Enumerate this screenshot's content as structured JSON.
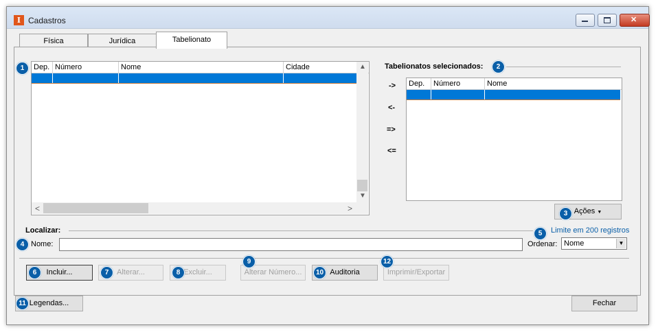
{
  "window": {
    "title": "Cadastros",
    "app_icon_letter": "I",
    "controls": {
      "minimize": "▬",
      "maximize": "□",
      "close": "✕"
    }
  },
  "tabs": [
    {
      "label": "Física",
      "active": false
    },
    {
      "label": "Jurídica",
      "active": false
    },
    {
      "label": "Tabelionato",
      "active": true
    }
  ],
  "left_grid": {
    "badge": "1",
    "columns": [
      "Dep.",
      "Número",
      "Nome",
      "Cidade"
    ],
    "selected_row": [
      "",
      "",
      "",
      ""
    ],
    "scroll": {
      "up": "▲",
      "down": "▼",
      "left": "<",
      "right": ">"
    }
  },
  "move_buttons": [
    "->",
    "<-",
    "=>",
    "<="
  ],
  "selected_section": {
    "title": "Tabelionatos selecionados:",
    "badge": "2",
    "columns": [
      "Dep.",
      "Número",
      "Nome"
    ],
    "selected_row": [
      "",
      "",
      ""
    ]
  },
  "actions_button": {
    "badge": "3",
    "label": "Ações",
    "caret": "▼"
  },
  "search": {
    "section_title": "Localizar:",
    "badge_name": "4",
    "name_label": "Nome:",
    "name_value": "",
    "badge_limit": "5",
    "limit_text": "Limite em 200 registros",
    "order_label": "Ordenar:",
    "order_value": "Nome"
  },
  "action_buttons": [
    {
      "badge": "6",
      "label": "Incluir...",
      "enabled": true
    },
    {
      "badge": "7",
      "label": "Alterar...",
      "enabled": false
    },
    {
      "badge": "8",
      "label": "Excluir...",
      "enabled": false
    },
    {
      "badge": "9",
      "label": "Alterar Número...",
      "enabled": false
    },
    {
      "badge": "10",
      "label": "Auditoria",
      "enabled": true
    },
    {
      "badge": "12",
      "label": "Imprimir/Exportar",
      "enabled": false
    }
  ],
  "footer": {
    "legend_badge": "11",
    "legend_label": "Legendas...",
    "close_label": "Fechar"
  }
}
